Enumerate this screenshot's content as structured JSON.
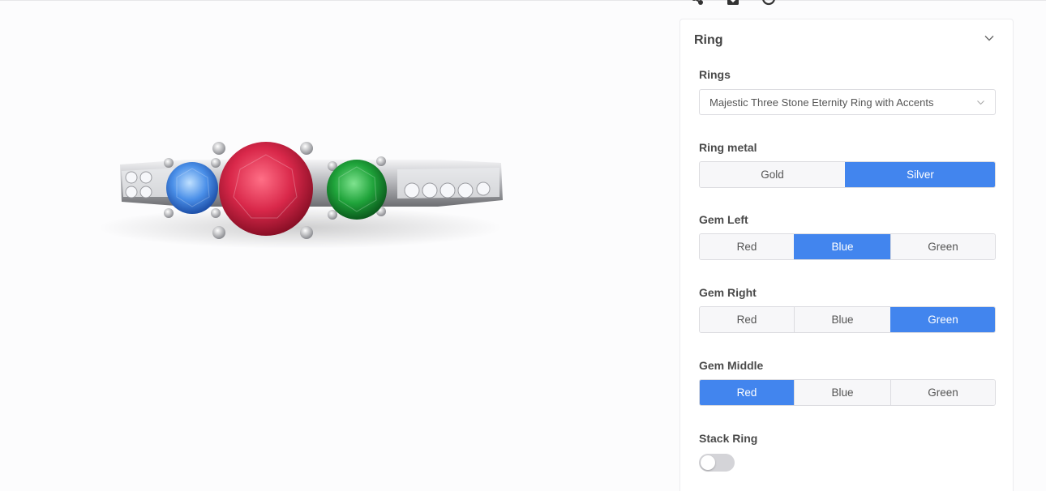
{
  "toolbar": {
    "icons": [
      "share-icon",
      "download-icon",
      "help-icon"
    ]
  },
  "panel": {
    "title": "Ring",
    "rings": {
      "label": "Rings",
      "selected": "Majestic Three Stone Eternity Ring with Accents"
    },
    "ring_metal": {
      "label": "Ring metal",
      "options": [
        "Gold",
        "Silver"
      ],
      "selected": "Silver"
    },
    "gem_left": {
      "label": "Gem Left",
      "options": [
        "Red",
        "Blue",
        "Green"
      ],
      "selected": "Blue"
    },
    "gem_right": {
      "label": "Gem Right",
      "options": [
        "Red",
        "Blue",
        "Green"
      ],
      "selected": "Green"
    },
    "gem_middle": {
      "label": "Gem Middle",
      "options": [
        "Red",
        "Blue",
        "Green"
      ],
      "selected": "Red"
    },
    "stack_ring": {
      "label": "Stack Ring",
      "on": false
    }
  },
  "colors": {
    "accent": "#4285ee",
    "ruby": "#d9284a",
    "sapphire": "#4a8fe8",
    "emerald": "#1fa33a",
    "metal": "#c8c9cc"
  }
}
